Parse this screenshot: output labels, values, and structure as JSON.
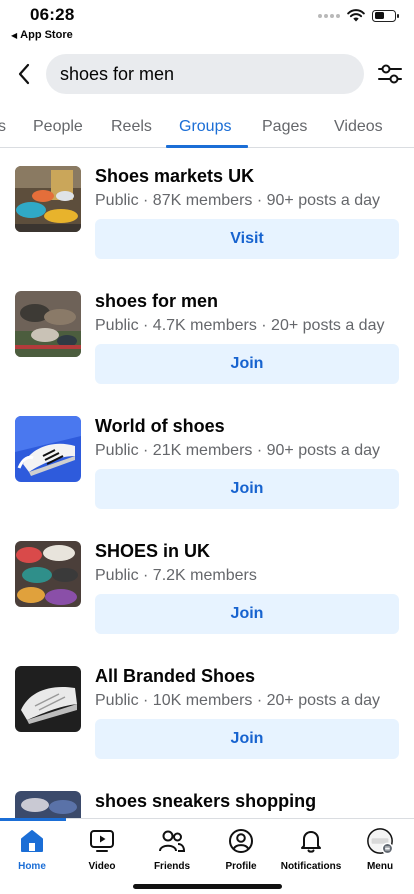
{
  "status": {
    "time": "06:28",
    "back_app": "App Store"
  },
  "search": {
    "query": "shoes for men"
  },
  "tabs": [
    {
      "label": "s",
      "active": false
    },
    {
      "label": "People",
      "active": false
    },
    {
      "label": "Reels",
      "active": false
    },
    {
      "label": "Groups",
      "active": true
    },
    {
      "label": "Pages",
      "active": false
    },
    {
      "label": "Videos",
      "active": false
    }
  ],
  "groups": [
    {
      "name": "Shoes markets UK",
      "meta": "Public · 87K members · 90+ posts a day",
      "action": "Visit"
    },
    {
      "name": "shoes for men",
      "meta": "Public · 4.7K members · 20+ posts a day",
      "action": "Join"
    },
    {
      "name": "World of shoes",
      "meta": "Public · 21K members · 90+ posts a day",
      "action": "Join"
    },
    {
      "name": "SHOES in UK",
      "meta": "Public · 7.2K members",
      "action": "Join"
    },
    {
      "name": "All Branded Shoes",
      "meta": "Public · 10K members · 20+ posts a day",
      "action": "Join"
    },
    {
      "name": "shoes sneakers shopping",
      "meta": "",
      "action": ""
    }
  ],
  "nav": {
    "home": "Home",
    "video": "Video",
    "friends": "Friends",
    "profile": "Profile",
    "notifications": "Notifications",
    "menu": "Menu"
  },
  "colors": {
    "accent": "#1b6ed6",
    "button_bg": "#e7f3ff",
    "secondary_text": "#65676b"
  }
}
